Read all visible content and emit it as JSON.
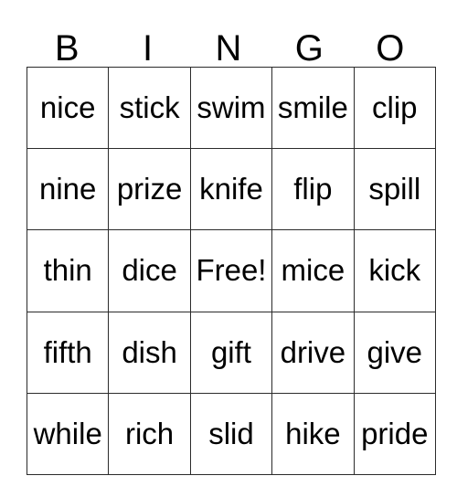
{
  "card": {
    "title": "BINGO",
    "headers": [
      "B",
      "I",
      "N",
      "G",
      "O"
    ],
    "free_space_label": "Free!",
    "free_space_position": {
      "row": 2,
      "col": 2
    },
    "grid_rows": 5,
    "grid_cols": 5,
    "colors": {
      "background": "#ffffff",
      "text": "#000000",
      "border": "#2b2b2b"
    },
    "rows": [
      {
        "cells": [
          "nice",
          "stick",
          "swim",
          "smile",
          "clip"
        ]
      },
      {
        "cells": [
          "nine",
          "prize",
          "knife",
          "flip",
          "spill"
        ]
      },
      {
        "cells": [
          "thin",
          "dice",
          "Free!",
          "mice",
          "kick"
        ]
      },
      {
        "cells": [
          "fifth",
          "dish",
          "gift",
          "drive",
          "give"
        ]
      },
      {
        "cells": [
          "while",
          "rich",
          "slid",
          "hike",
          "pride"
        ]
      }
    ]
  }
}
